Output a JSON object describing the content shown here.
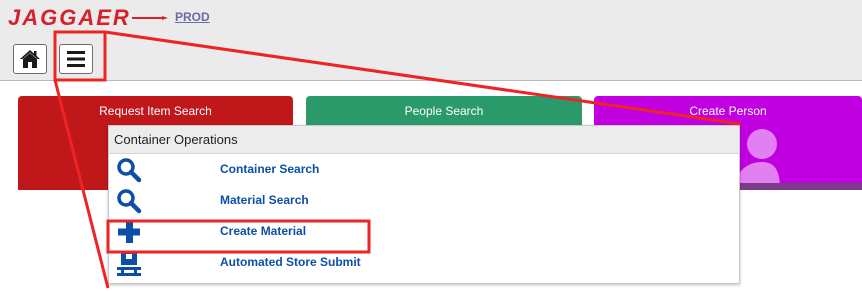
{
  "header": {
    "logo_text": "JAGGAER",
    "environment_link": "PROD"
  },
  "toolbar": {
    "home_icon": "home-icon",
    "menu_icon": "hamburger-menu-icon"
  },
  "tiles": [
    {
      "label": "Request Item Search",
      "color": "#c0171b"
    },
    {
      "label": "People Search",
      "color": "#2b9a6b"
    },
    {
      "label": "Create Person",
      "color": "#c000e0"
    }
  ],
  "menu": {
    "header": "Container Operations",
    "items": [
      {
        "label": "Container Search",
        "icon": "search-icon"
      },
      {
        "label": "Material Search",
        "icon": "search-icon"
      },
      {
        "label": "Create Material",
        "icon": "plus-icon",
        "highlighted": true
      },
      {
        "label": "Automated Store Submit",
        "icon": "store-submit-icon"
      }
    ]
  },
  "colors": {
    "brand": "#d8202c",
    "link": "#0d4fa8",
    "annotation": "#ee2424"
  }
}
